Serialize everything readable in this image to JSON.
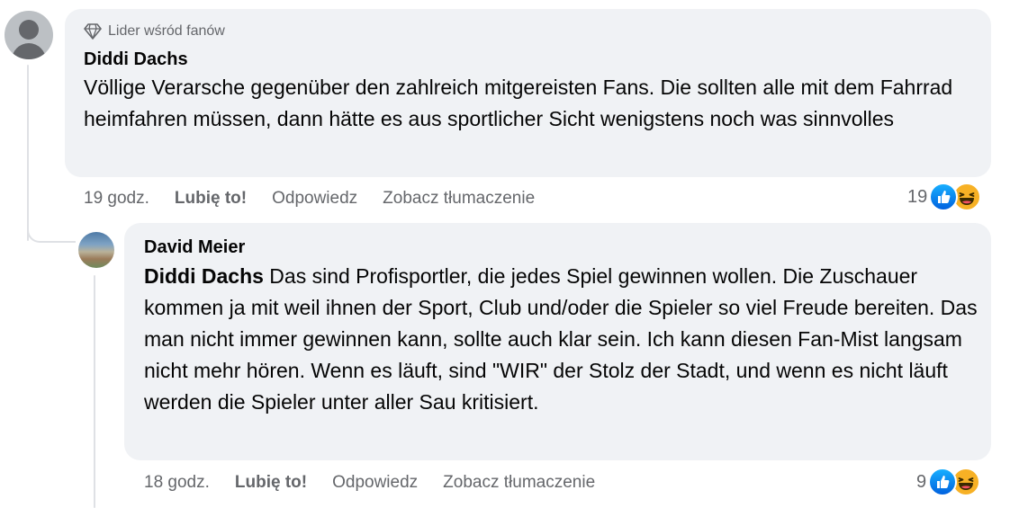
{
  "comment": {
    "badge_label": "Lider wśród fanów",
    "badge_icon": "diamond-icon",
    "author": "Diddi Dachs",
    "body": "Völlige Verarsche gegenüber den zahlreich mitgereisten Fans. Die sollten alle mit dem Fahrrad heimfahren müssen, dann hätte es aus sportlicher Sicht wenigstens noch was sinnvolles",
    "time": "19 godz.",
    "like_label": "Lubię to!",
    "reply_label": "Odpowiedz",
    "translate_label": "Zobacz tłumaczenie",
    "reaction_count": "19",
    "reactions": [
      "like-icon",
      "haha-icon"
    ]
  },
  "reply": {
    "author": "David Meier",
    "mention": "Diddi Dachs",
    "body": " Das sind Profisportler, die jedes Spiel gewinnen wollen. Die Zuschauer kommen ja mit weil ihnen der Sport, Club und/oder die Spieler so viel Freude bereiten. Das man nicht immer gewinnen kann, sollte auch klar sein. Ich kann diesen Fan-Mist langsam nicht mehr hören. Wenn es läuft, sind \"WIR\" der Stolz der Stadt, und wenn es nicht läuft werden die Spieler unter aller Sau kritisiert.",
    "time": "18 godz.",
    "like_label": "Lubię to!",
    "reply_label": "Odpowiedz",
    "translate_label": "Zobacz tłumaczenie",
    "reaction_count": "9",
    "reactions": [
      "like-icon",
      "haha-icon"
    ]
  },
  "colors": {
    "bubble_bg": "#f0f2f5",
    "secondary_text": "#65676b",
    "like_blue": "#0866ff",
    "haha_yellow": "#f7b125"
  }
}
